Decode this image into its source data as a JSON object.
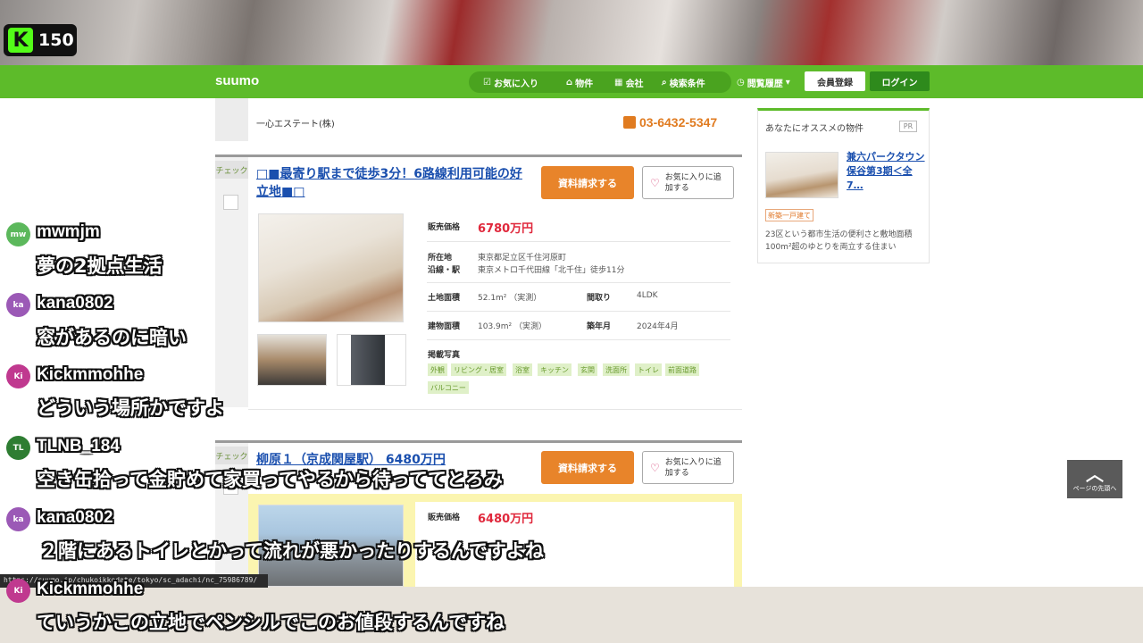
{
  "stream": {
    "viewer_count": "150",
    "logo_letter": "K"
  },
  "header": {
    "logo": "suumo",
    "nav": [
      "お気に入り",
      "物件",
      "会社",
      "検索条件"
    ],
    "history": "閲覧履歴",
    "register": "会員登録",
    "login": "ログイン"
  },
  "top_listing": {
    "company": "一心エステート(株)",
    "phone": "03-6432-5347"
  },
  "listing1": {
    "check_label": "チェック",
    "title": "□■最寄り駅まで徒歩3分！6路線利用可能の好立地■□",
    "request_btn": "資料請求する",
    "fav_btn": "お気に入りに追加する",
    "price_label": "販売価格",
    "price": "6780万円",
    "location_label": "所在地",
    "location": "東京都足立区千住河原町",
    "line_label": "沿線・駅",
    "line": "東京メトロ千代田線「北千住」徒歩11分",
    "land_label": "土地面積",
    "land": "52.1m² （実測）",
    "layout_label": "間取り",
    "layout": "4LDK",
    "building_label": "建物面積",
    "building": "103.9m² （実測）",
    "built_label": "築年月",
    "built": "2024年4月",
    "photos_label": "掲載写真",
    "tags": [
      "外観",
      "リビング・居室",
      "浴室",
      "キッチン",
      "玄関",
      "洗面所",
      "トイレ",
      "前面道路",
      "バルコニー"
    ]
  },
  "listing2": {
    "check_label": "チェック",
    "title": "柳原１（京成関屋駅） 6480万円",
    "request_btn": "資料請求する",
    "fav_btn": "お気に入りに追加する",
    "price_label": "販売価格",
    "price": "6480万円"
  },
  "sidebar": {
    "title": "あなたにオススメの物件",
    "pr": "PR",
    "item_title": "兼六パークタウン保谷第3期＜全7…",
    "badge": "新築一戸建て",
    "desc": "23区という都市生活の便利さと敷地面積100m²超のゆとりを両立する住まい"
  },
  "page_top": {
    "label": "ページの先頭へ"
  },
  "status_url": "https://suumo.jp/chukoikkodate/tokyo/sc_adachi/nc_75986789/",
  "chat": [
    {
      "user": "mwmjm",
      "initials": "mw",
      "color": "#5cb85c",
      "message": "夢の2拠点生活"
    },
    {
      "user": "kana0802",
      "initials": "ka",
      "color": "#9b59b6",
      "message": "窓があるのに暗い"
    },
    {
      "user": "Kickmmohhe",
      "initials": "Ki",
      "color": "#c0398f",
      "message": "どういう場所かですよ"
    },
    {
      "user": "TLNB_184",
      "initials": "TL",
      "color": "#2e7d32",
      "message": "空き缶拾って金貯めて家買ってやるから待っててとろみ"
    },
    {
      "user": "kana0802",
      "initials": "ka",
      "color": "#9b59b6",
      "message": "２階にあるトイレとかって流れが悪かったりするんですよね"
    },
    {
      "user": "Kickmmohhe",
      "initials": "Ki",
      "color": "#c0398f",
      "message": "ていうかこの立地でペンシルでこのお値段するんですね"
    }
  ]
}
